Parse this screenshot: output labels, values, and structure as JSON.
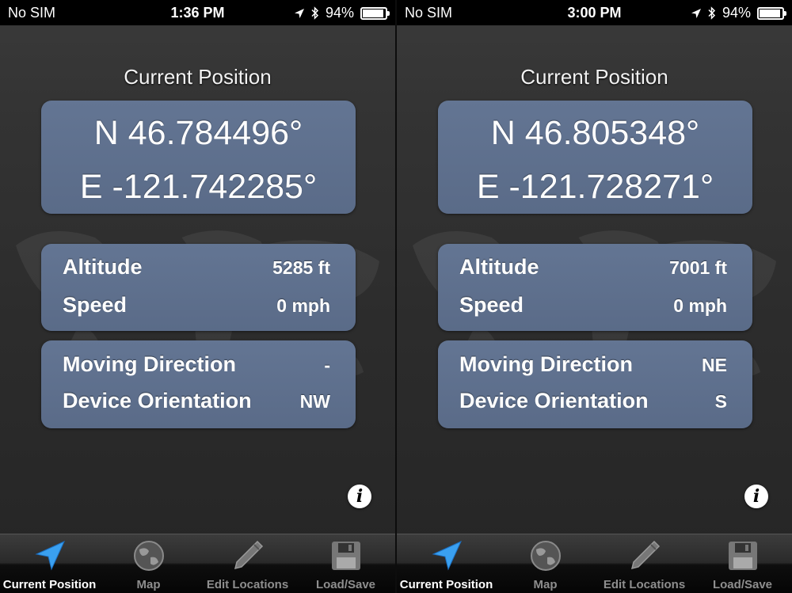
{
  "screens": [
    {
      "status": {
        "carrier": "No SIM",
        "time": "1:36 PM",
        "battery": "94%"
      },
      "title": "Current Position",
      "coords": {
        "lat": "N 46.784496°",
        "lon": "E -121.742285°"
      },
      "altitude": {
        "label": "Altitude",
        "value": "5285 ft"
      },
      "speed": {
        "label": "Speed",
        "value": "0 mph"
      },
      "moving_direction": {
        "label": "Moving Direction",
        "value": "-"
      },
      "device_orientation": {
        "label": "Device Orientation",
        "value": "NW"
      },
      "info_label": "i"
    },
    {
      "status": {
        "carrier": "No SIM",
        "time": "3:00 PM",
        "battery": "94%"
      },
      "title": "Current Position",
      "coords": {
        "lat": "N 46.805348°",
        "lon": "E -121.728271°"
      },
      "altitude": {
        "label": "Altitude",
        "value": "7001 ft"
      },
      "speed": {
        "label": "Speed",
        "value": "0 mph"
      },
      "moving_direction": {
        "label": "Moving Direction",
        "value": "NE"
      },
      "device_orientation": {
        "label": "Device Orientation",
        "value": "S"
      },
      "info_label": "i"
    }
  ],
  "battery_level": 0.94,
  "tabs": [
    {
      "label": "Current Position",
      "icon": "location-arrow-icon",
      "active": true
    },
    {
      "label": "Map",
      "icon": "globe-icon",
      "active": false
    },
    {
      "label": "Edit Locations",
      "icon": "pencil-icon",
      "active": false
    },
    {
      "label": "Load/Save",
      "icon": "floppy-disk-icon",
      "active": false
    }
  ],
  "colors": {
    "panel": "#5f7090",
    "active_tab": "#3aa0f0",
    "background": "#2e2e2e"
  }
}
